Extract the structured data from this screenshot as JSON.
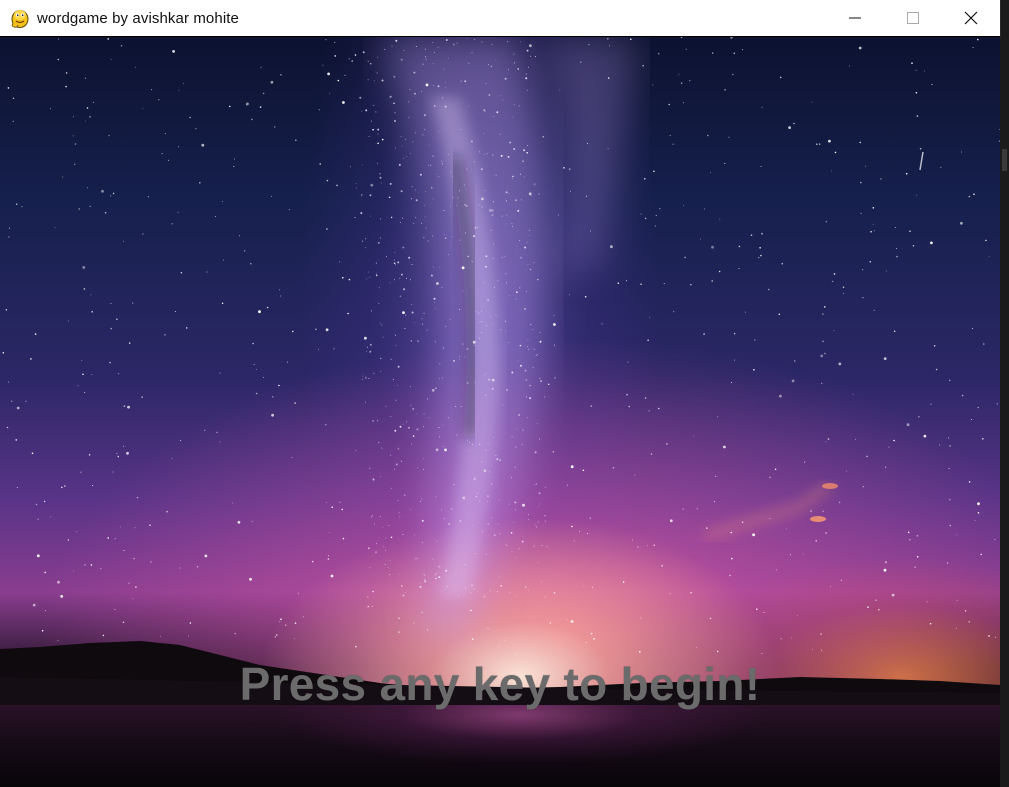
{
  "window": {
    "title": "wordgame by avishkar mohite",
    "app_icon": "python-snake-icon"
  },
  "controls": {
    "minimize_icon": "minimize-icon",
    "maximize_icon": "maximize-icon",
    "close_icon": "close-icon"
  },
  "scene": {
    "background": "night-sky-milky-way",
    "prompt_text": "Press any key to begin!",
    "prompt_color": "#6b6b6b"
  }
}
